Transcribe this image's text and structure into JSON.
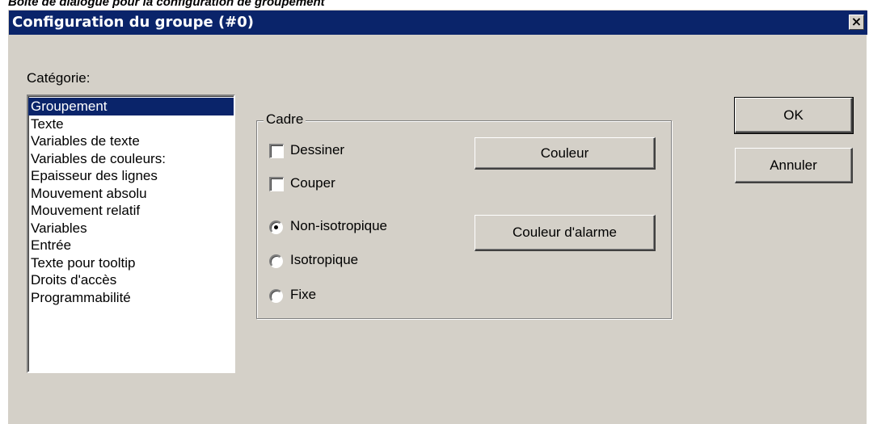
{
  "caption": "Boîte de dialogue pour la configuration de groupement",
  "dialog": {
    "title": "Configuration du groupe (#0)",
    "close_label": "×"
  },
  "category": {
    "label": "Catégorie:",
    "items": [
      {
        "label": "Groupement",
        "selected": true
      },
      {
        "label": "Texte"
      },
      {
        "label": "Variables de texte"
      },
      {
        "label": "Variables de couleurs:"
      },
      {
        "label": "Epaisseur des lignes"
      },
      {
        "label": "Mouvement absolu"
      },
      {
        "label": "Mouvement relatif"
      },
      {
        "label": "Variables"
      },
      {
        "label": "Entrée"
      },
      {
        "label": "Texte pour tooltip"
      },
      {
        "label": "Droits d'accès"
      },
      {
        "label": "Programmabilité"
      }
    ]
  },
  "frame": {
    "legend": "Cadre",
    "checkboxes": [
      {
        "label": "Dessiner",
        "checked": false
      },
      {
        "label": "Couper",
        "checked": false
      }
    ],
    "radios": [
      {
        "label": "Non-isotropique",
        "checked": true
      },
      {
        "label": "Isotropique",
        "checked": false
      },
      {
        "label": "Fixe",
        "checked": false
      }
    ],
    "color_button": "Couleur",
    "alarm_color_button": "Couleur d'alarme"
  },
  "buttons": {
    "ok": "OK",
    "cancel": "Annuler"
  },
  "colors": {
    "titlebar": "#0a246a",
    "face": "#d4d0c8",
    "selection": "#0a246a"
  }
}
